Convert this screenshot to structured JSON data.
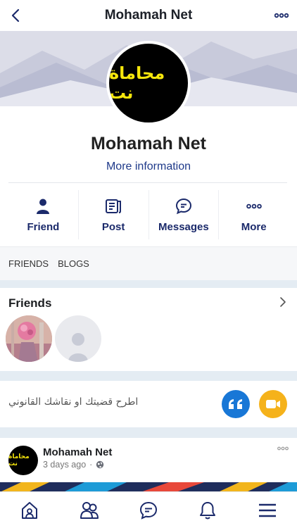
{
  "header": {
    "title": "Mohamah Net",
    "back_icon": "chevron-left-icon",
    "more_icon": "more-dots-icon"
  },
  "profile": {
    "avatar_logo_text": "محاماة نت",
    "name": "Mohamah Net",
    "more_info_label": "More information"
  },
  "actions": [
    {
      "label": "Friend",
      "icon": "person-icon"
    },
    {
      "label": "Post",
      "icon": "post-icon"
    },
    {
      "label": "Messages",
      "icon": "chat-bubble-icon"
    },
    {
      "label": "More",
      "icon": "more-dots-icon"
    }
  ],
  "tabs": [
    "FRIENDS",
    "BLOGS"
  ],
  "friends": {
    "title": "Friends"
  },
  "composer": {
    "placeholder": "اطرح قضيتك او نقاشك القانوني"
  },
  "post": {
    "author": "Mohamah Net",
    "time": "3 days ago",
    "avatar_logo_text": "محاماة نت"
  },
  "bottom_nav": [
    "home-icon",
    "friends-icon",
    "messages-icon",
    "notifications-icon",
    "menu-icon"
  ],
  "colors": {
    "accent": "#1b2a6b",
    "link": "#1f3a8a",
    "quote": "#1877d6",
    "video": "#f5b21b",
    "logo_text": "#f6e60c"
  }
}
